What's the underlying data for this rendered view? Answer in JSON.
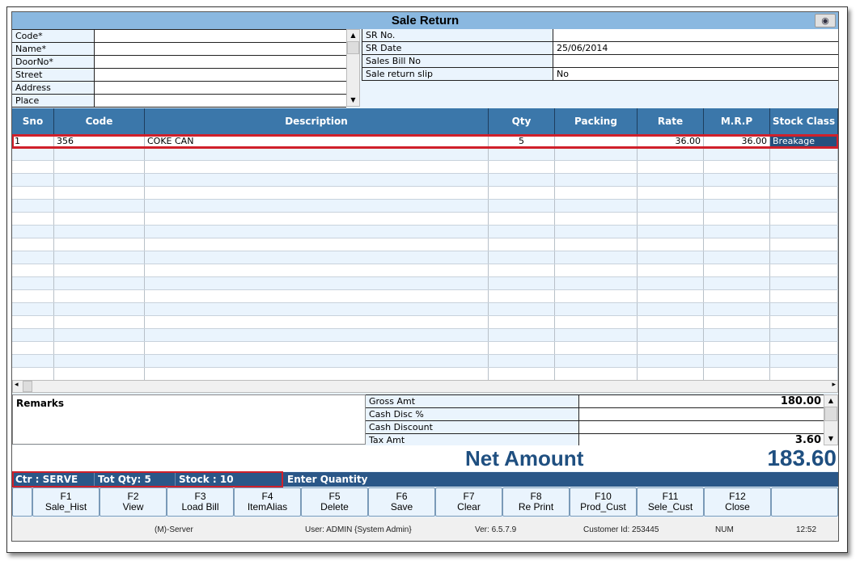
{
  "window": {
    "title": "Sale Return"
  },
  "customer_form": [
    {
      "label": "Code*",
      "value": ""
    },
    {
      "label": "Name*",
      "value": ""
    },
    {
      "label": "DoorNo*",
      "value": ""
    },
    {
      "label": "Street",
      "value": ""
    },
    {
      "label": "Address",
      "value": ""
    },
    {
      "label": "Place",
      "value": ""
    }
  ],
  "return_form": [
    {
      "label": "SR No.",
      "value": ""
    },
    {
      "label": "SR Date",
      "value": "25/06/2014"
    },
    {
      "label": "Sales Bill No",
      "value": ""
    },
    {
      "label": "Sale return slip",
      "value": "No"
    }
  ],
  "grid": {
    "columns": [
      "Sno",
      "Code",
      "Description",
      "Qty",
      "Packing",
      "Rate",
      "M.R.P",
      "Stock Class"
    ],
    "rows": [
      {
        "sno": "1",
        "code": "356",
        "description": "COKE CAN",
        "qty": "5",
        "packing": "",
        "rate": "36.00",
        "mrp": "36.00",
        "stock_class": "Breakage"
      }
    ]
  },
  "remarks_label": "Remarks",
  "totals": [
    {
      "label": "Gross Amt",
      "value": "180.00"
    },
    {
      "label": "Cash Disc %",
      "value": ""
    },
    {
      "label": "Cash Discount",
      "value": ""
    },
    {
      "label": "Tax Amt",
      "value": "3.60"
    }
  ],
  "net": {
    "label": "Net Amount",
    "value": "183.60"
  },
  "status": {
    "ctr": "Ctr : SERVE",
    "tot_qty": "Tot Qty: 5",
    "stock": "Stock : 10",
    "message": "Enter Quantity"
  },
  "fkeys": [
    {
      "key": "F1",
      "label": "Sale_Hist"
    },
    {
      "key": "F2",
      "label": "View"
    },
    {
      "key": "F3",
      "label": "Load Bill"
    },
    {
      "key": "F4",
      "label": "ItemAlias"
    },
    {
      "key": "F5",
      "label": "Delete"
    },
    {
      "key": "F6",
      "label": "Save"
    },
    {
      "key": "F7",
      "label": "Clear"
    },
    {
      "key": "F8",
      "label": "Re Print"
    },
    {
      "key": "F10",
      "label": "Prod_Cust"
    },
    {
      "key": "F11",
      "label": "Sele_Cust"
    },
    {
      "key": "F12",
      "label": "Close"
    }
  ],
  "footer": {
    "server": "(M)-Server",
    "user": "User: ADMIN {System Admin}",
    "version": "Ver: 6.5.7.9",
    "customer_id": "Customer Id: 253445",
    "num": "NUM",
    "time": "12:52"
  },
  "colors": {
    "header": "#3b77aa",
    "status": "#2a5788",
    "accent": "#d0202a",
    "net": "#1f4f80"
  }
}
